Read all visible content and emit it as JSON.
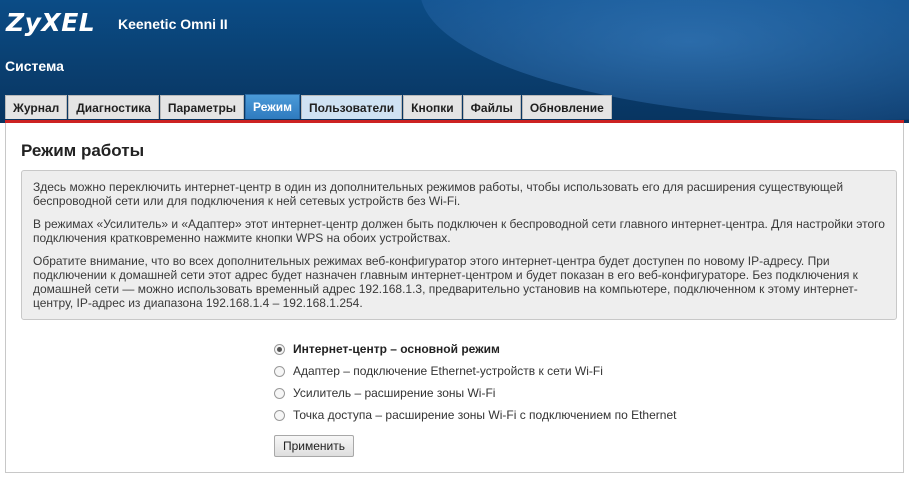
{
  "header": {
    "brand": "ZyXEL",
    "model": "Keenetic Omni II",
    "section": "Система"
  },
  "tabs": [
    {
      "label": "Журнал",
      "active": false
    },
    {
      "label": "Диагностика",
      "active": false
    },
    {
      "label": "Параметры",
      "active": false
    },
    {
      "label": "Режим",
      "active": true
    },
    {
      "label": "Пользователи",
      "active": false
    },
    {
      "label": "Кнопки",
      "active": false
    },
    {
      "label": "Файлы",
      "active": false
    },
    {
      "label": "Обновление",
      "active": false
    }
  ],
  "panel": {
    "title": "Режим работы",
    "info": [
      "Здесь можно переключить интернет-центр в один из дополнительных режимов работы, чтобы использовать его для расширения существующей беспроводной сети или для подключения к ней сетевых устройств без Wi-Fi.",
      "В режимах «Усилитель» и «Адаптер» этот интернет-центр должен быть подключен к беспроводной сети главного интернет-центра. Для настройки этого подключения кратковременно нажмите кнопки WPS на обоих устройствах.",
      "Обратите внимание, что во всех дополнительных режимах веб-конфигуратор этого интернет-центра будет доступен по новому IP-адресу. При подключении к домашней сети этот адрес будет назначен главным интернет-центром и будет показан в его веб-конфигураторе. Без подключения к домашней сети — можно использовать временный адрес 192.168.1.3, предварительно установив на компьютере, подключенном к этому интернет-центру, IP-адрес из диапазона 192.168.1.4 – 192.168.1.254."
    ],
    "modes": [
      {
        "label": "Интернет-центр – основной режим",
        "selected": true
      },
      {
        "label": "Адаптер – подключение Ethernet-устройств к сети Wi-Fi",
        "selected": false
      },
      {
        "label": "Усилитель – расширение зоны Wi-Fi",
        "selected": false
      },
      {
        "label": "Точка доступа – расширение зоны Wi-Fi с подключением по Ethernet",
        "selected": false
      }
    ],
    "apply_label": "Применить"
  },
  "colors": {
    "header_blue": "#0a3f70",
    "active_tab": "#2f7bbf",
    "accent_red": "#cc2222"
  }
}
